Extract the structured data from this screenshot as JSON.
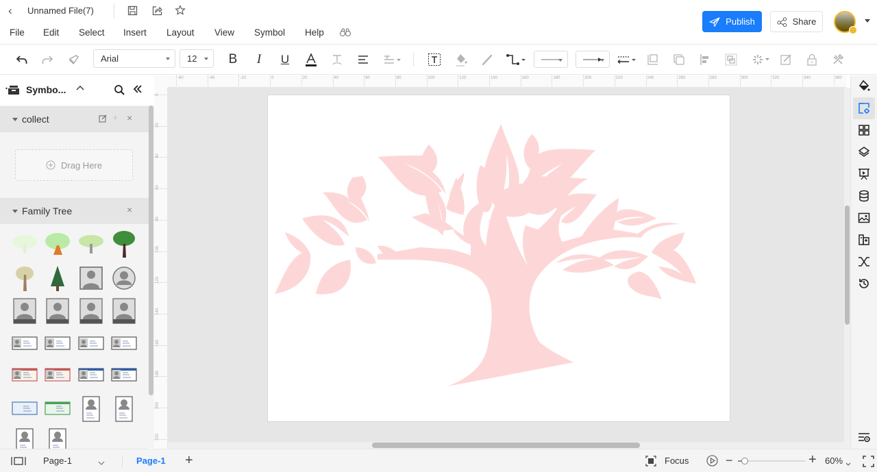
{
  "header": {
    "file_name": "Unnamed File(7)",
    "icons": [
      "back-icon",
      "save-icon",
      "export-icon",
      "star-icon"
    ],
    "menu": [
      "File",
      "Edit",
      "Select",
      "Insert",
      "Layout",
      "View",
      "Symbol",
      "Help"
    ],
    "publish_label": "Publish",
    "share_label": "Share"
  },
  "toolbar": {
    "font_family": "Arial",
    "font_size": "12",
    "tools": [
      "undo",
      "redo",
      "format-painter",
      "bold",
      "italic",
      "underline",
      "font-color",
      "text-style",
      "align",
      "spacing",
      "text-box",
      "fill",
      "line-color",
      "connector",
      "line-style",
      "arrow-style",
      "line-jump",
      "bring-front",
      "send-back",
      "align-objects",
      "group",
      "effects",
      "edit-shape",
      "lock",
      "tools"
    ]
  },
  "left_panel": {
    "title": "Symbo...",
    "sections": [
      {
        "label": "collect",
        "drag_text": "Drag Here"
      },
      {
        "label": "Family Tree"
      }
    ],
    "symbols": [
      "light-tree",
      "cloud-tree",
      "bushy-tree",
      "green-tree",
      "bare-tree",
      "pine-tree",
      "photo-square",
      "photo-circle",
      "photo-label-1",
      "photo-label-2",
      "photo-label-3",
      "photo-label-4",
      "card-gray-1",
      "card-gray-2",
      "card-gray-3",
      "card-gray-4",
      "card-red-1",
      "card-red-2",
      "card-blue-1",
      "card-blue-2",
      "card-lightblue",
      "card-green",
      "portrait-card-1",
      "portrait-card-2",
      "portrait-card-3",
      "portrait-card-4"
    ]
  },
  "ruler": {
    "top_labels": [
      "-60",
      "-40",
      "-20",
      "0",
      "20",
      "40",
      "60",
      "80",
      "100",
      "120",
      "140",
      "160",
      "180",
      "200",
      "220",
      "240",
      "260",
      "280",
      "300",
      "320",
      "340",
      "360"
    ],
    "left_labels": [
      "0",
      "20",
      "40",
      "60",
      "80",
      "100",
      "120",
      "140",
      "160",
      "180",
      "200",
      "220"
    ]
  },
  "canvas": {
    "tree_color": "#fdd7d7"
  },
  "right_panel": {
    "items": [
      "fill-icon",
      "page-settings-icon",
      "grid-icon",
      "layers-icon",
      "presentation-icon",
      "database-icon",
      "image-icon",
      "symbols-icon",
      "connector-icon",
      "history-icon"
    ],
    "active": 1
  },
  "status": {
    "page_selector": "Page-1",
    "active_tab": "Page-1",
    "focus_label": "Focus",
    "zoom": "60%",
    "zoom_fraction": 0.1
  },
  "colors": {
    "accent": "#1a7dfb",
    "avatar_ring": "#f3b82b"
  }
}
